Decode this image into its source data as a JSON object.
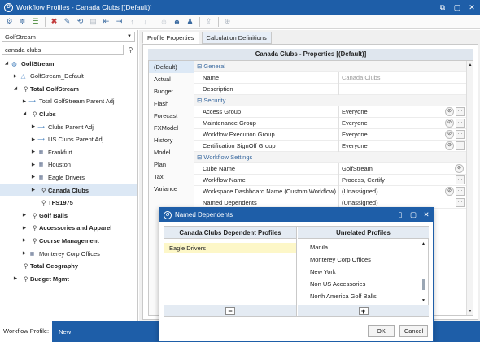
{
  "window": {
    "title": "Workflow Profiles - Canada Clubs [(Default)]",
    "app_icon": "onestream-logo",
    "controls": [
      "restore-icon",
      "maximize-icon",
      "close-icon"
    ]
  },
  "toolbar": {
    "icons": [
      "settings-icon",
      "filter-icon",
      "tree-icon",
      "delete-icon",
      "edit-icon",
      "refresh-icon",
      "save-icon",
      "collapse-icon",
      "expand-icon",
      "move-up-icon",
      "move-down-icon",
      "add-user-icon",
      "add-users-icon",
      "user-group-icon",
      "share-icon",
      "globe-icon"
    ]
  },
  "left": {
    "cube_select": "GolfStream",
    "search_value": "canada clubs",
    "tree": [
      {
        "label": "GolfStream",
        "icon": "cube-icon",
        "level": 0,
        "toggle": "open",
        "bold": true
      },
      {
        "label": "GolfStream_Default",
        "icon": "triangle-icon",
        "level": 1,
        "toggle": "closed",
        "bold": false
      },
      {
        "label": "Total GolfStream",
        "icon": "scenario-icon",
        "level": 1,
        "toggle": "open",
        "bold": true
      },
      {
        "label": "Total GolfStream Parent Adj",
        "icon": "arrow-icon",
        "level": 2,
        "toggle": "closed",
        "bold": false
      },
      {
        "label": "Clubs",
        "icon": "scenario-icon",
        "level": 2,
        "toggle": "open",
        "bold": true
      },
      {
        "label": "Clubs Parent Adj",
        "icon": "arrow-icon",
        "level": 3,
        "toggle": "closed",
        "bold": false
      },
      {
        "label": "US Clubs Parent Adj",
        "icon": "arrow-icon",
        "level": 3,
        "toggle": "closed",
        "bold": false
      },
      {
        "label": "Frankfurt",
        "icon": "grid-icon",
        "level": 3,
        "toggle": "closed",
        "bold": false
      },
      {
        "label": "Houston",
        "icon": "grid-icon",
        "level": 3,
        "toggle": "closed",
        "bold": false
      },
      {
        "label": "Eagle Drivers",
        "icon": "grid-icon",
        "level": 3,
        "toggle": "closed",
        "bold": false
      },
      {
        "label": "Canada Clubs",
        "icon": "scenario-icon",
        "level": 3,
        "toggle": "closed",
        "bold": true,
        "selected": true
      },
      {
        "label": "TFS1975",
        "icon": "scenario-icon",
        "level": 3,
        "toggle": "",
        "bold": true
      },
      {
        "label": "Golf Balls",
        "icon": "scenario-icon",
        "level": 2,
        "toggle": "closed",
        "bold": true
      },
      {
        "label": "Accessories and Apparel",
        "icon": "scenario-icon",
        "level": 2,
        "toggle": "closed",
        "bold": true
      },
      {
        "label": "Course Management",
        "icon": "scenario-icon",
        "level": 2,
        "toggle": "closed",
        "bold": true
      },
      {
        "label": "Monterey Corp Offices",
        "icon": "grid-icon",
        "level": 2,
        "toggle": "closed",
        "bold": false
      },
      {
        "label": "Total Geography",
        "icon": "scenario-icon",
        "level": 1,
        "toggle": "",
        "bold": true
      },
      {
        "label": "Budget Mgmt",
        "icon": "scenario-icon",
        "level": 1,
        "toggle": "closed",
        "bold": true
      }
    ]
  },
  "tabs": [
    "Profile Properties",
    "Calculation Definitions"
  ],
  "properties": {
    "title": "Canada Clubs - Properties  [(Default)]",
    "scenarios": [
      "(Default)",
      "Actual",
      "Budget",
      "Flash",
      "Forecast",
      "FXModel",
      "History",
      "Model",
      "Plan",
      "Tax",
      "Variance"
    ],
    "rows": [
      {
        "type": "cat",
        "name": "General"
      },
      {
        "type": "prop",
        "name": "Name",
        "value": "Canada Clubs",
        "dim": true,
        "buttons": []
      },
      {
        "type": "prop",
        "name": "Description",
        "value": "",
        "buttons": []
      },
      {
        "type": "cat",
        "name": "Security"
      },
      {
        "type": "prop",
        "name": "Access Group",
        "value": "Everyone",
        "buttons": [
          "round",
          "dots"
        ]
      },
      {
        "type": "prop",
        "name": "Maintenance Group",
        "value": "Everyone",
        "buttons": [
          "round",
          "dots"
        ]
      },
      {
        "type": "prop",
        "name": "Workflow Execution Group",
        "value": "Everyone",
        "buttons": [
          "round",
          "dots"
        ]
      },
      {
        "type": "prop",
        "name": "Certification SignOff Group",
        "value": "Everyone",
        "buttons": [
          "round",
          "dots"
        ]
      },
      {
        "type": "cat",
        "name": "Workflow Settings"
      },
      {
        "type": "prop",
        "name": "Cube Name",
        "value": "GolfStream",
        "buttons": [
          "round-end"
        ]
      },
      {
        "type": "prop",
        "name": "Workflow Name",
        "value": "Process, Certify",
        "buttons": [
          "dots"
        ]
      },
      {
        "type": "prop",
        "name": "Workspace Dashboard Name (Custom Workflow)",
        "value": "(Unassigned)",
        "buttons": [
          "round",
          "dots"
        ]
      },
      {
        "type": "prop",
        "name": "Named Dependents",
        "value": "(Unassigned)",
        "buttons": [
          "dots"
        ]
      }
    ]
  },
  "dialog": {
    "title": "Named Dependents",
    "left_header": "Canada Clubs Dependent Profiles",
    "left_items": [
      "Eagle Drivers"
    ],
    "right_header": "Unrelated Profiles",
    "right_items": [
      "Manila",
      "Monterey Corp Offices",
      "New York",
      "Non US Accessories",
      "North America Golf Balls"
    ],
    "remove_symbol": "−",
    "add_symbol": "+",
    "ok": "OK",
    "cancel": "Cancel"
  },
  "status": {
    "label": "Workflow Profile:",
    "value": "New"
  }
}
